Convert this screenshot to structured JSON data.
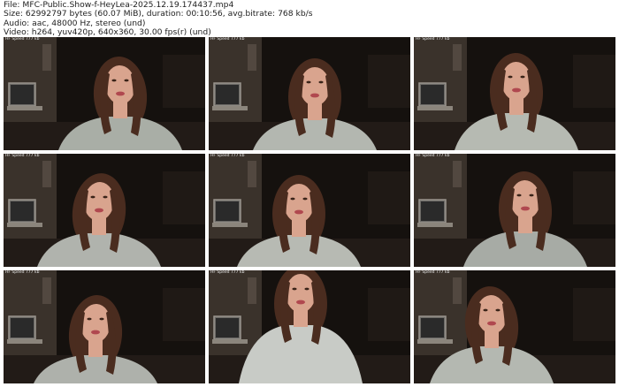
{
  "header": {
    "file_line": "File: MFC-Public.Show-f-HeyLea-2025.12.19.174437.mp4",
    "size_line": "Size: 62992797 bytes (60.07 MiB), duration: 00:10:56, avg.bitrate: 768 kb/s",
    "audio_line": "Audio: aac, 48000 Hz, stereo (und)",
    "video_line": "Video: h264, yuv420p, 640x360, 30.00 fps(r) (und)"
  },
  "thumbnails": [
    {
      "overlay": "HF Speed 777 kb"
    },
    {
      "overlay": "HF Speed 777 kb"
    },
    {
      "overlay": "HF Speed 777 kb"
    },
    {
      "overlay": "HF Speed 777 kb"
    },
    {
      "overlay": "HF Speed 777 kb"
    },
    {
      "overlay": "HF Speed 777 kb"
    },
    {
      "overlay": "HF Speed 777 kb"
    },
    {
      "overlay": "HF Speed 777 kb"
    },
    {
      "overlay": "HF Speed 777 kb"
    }
  ],
  "colors": {
    "background": "#ffffff",
    "text": "#222222",
    "room_dark": "#15110e",
    "wall": "#3a322b",
    "skin": "#d9a48e",
    "hair": "#4a2c1f",
    "sweater": "#b9bcb6"
  }
}
